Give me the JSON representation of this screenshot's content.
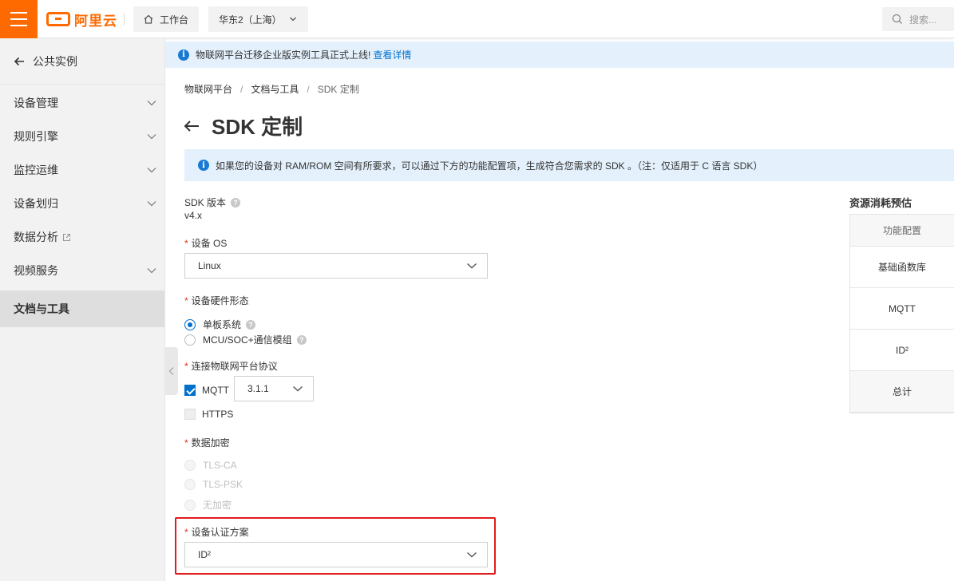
{
  "topbar": {
    "logo_text": "阿里云",
    "workbench_label": "工作台",
    "region_label": "华东2（上海）",
    "search_placeholder": "搜索..."
  },
  "sidebar": {
    "back_label": "公共实例",
    "items": [
      {
        "label": "设备管理"
      },
      {
        "label": "规则引擎"
      },
      {
        "label": "监控运维"
      },
      {
        "label": "设备划归"
      },
      {
        "label": "数据分析"
      },
      {
        "label": "视频服务"
      },
      {
        "label": "文档与工具"
      }
    ]
  },
  "notice": {
    "text": "物联网平台迁移企业版实例工具正式上线!",
    "link": "查看详情"
  },
  "breadcrumb": [
    "物联网平台",
    "文档与工具",
    "SDK 定制"
  ],
  "page_title": "SDK 定制",
  "tip": "如果您的设备对 RAM/ROM 空间有所要求，可以通过下方的功能配置项，生成符合您需求的 SDK 。（注：仅适用于 C 语言 SDK）",
  "form": {
    "sdk_version_label": "SDK 版本",
    "sdk_version_value": "v4.x",
    "os_label": "设备 OS",
    "os_value": "Linux",
    "hardware_label": "设备硬件形态",
    "hardware_options": [
      "单板系统",
      "MCU/SOC+通信模组"
    ],
    "hardware_selected": "单板系统",
    "protocol_label": "连接物联网平台协议",
    "protocol_mqtt": "MQTT",
    "protocol_mqtt_version": "3.1.1",
    "protocol_https": "HTTPS",
    "encryption_label": "数据加密",
    "encryption_options": [
      "TLS-CA",
      "TLS-PSK",
      "无加密"
    ],
    "auth_label": "设备认证方案",
    "auth_value": "ID²"
  },
  "resource": {
    "title": "资源消耗预估",
    "header": "功能配置",
    "rows": [
      "基础函数库",
      "MQTT",
      "ID²",
      "总计"
    ]
  },
  "colors": {
    "brand": "#ff6a00",
    "primary": "#0070cc",
    "highlight": "#e21b1b"
  }
}
